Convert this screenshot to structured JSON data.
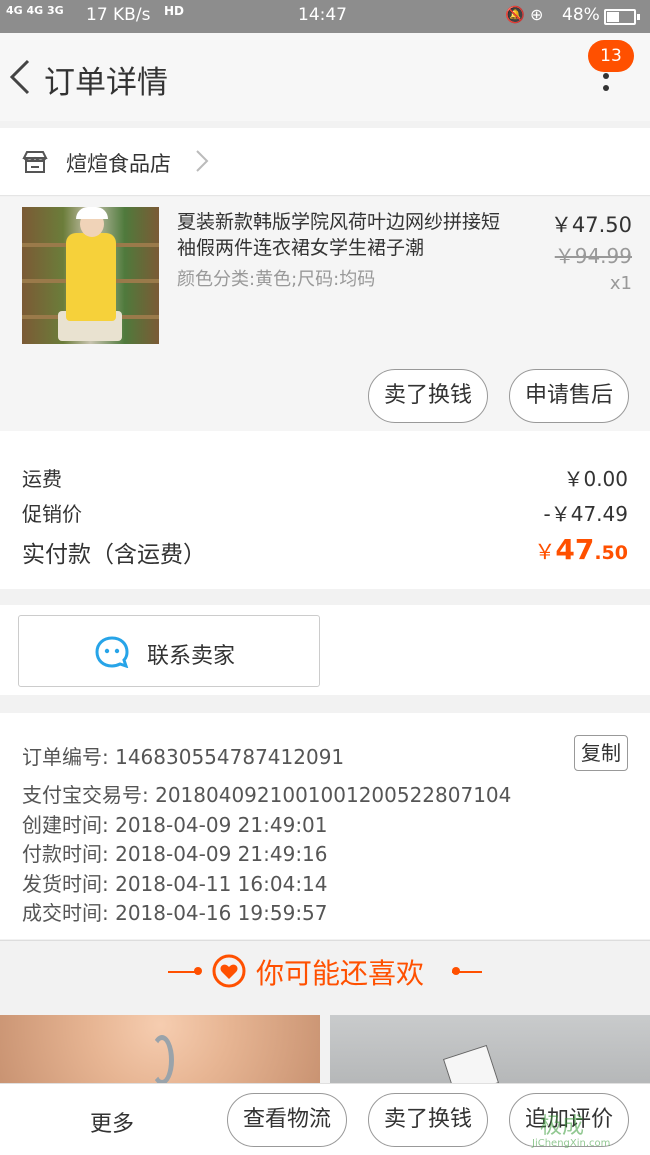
{
  "status_bar": {
    "signal": "4G 4G 3G",
    "net_speed": "17 KB/s",
    "hd": "HD",
    "time": "14:47",
    "icons": "🔕 ⊕",
    "battery_pct": "48%",
    "battery_level": 0.48
  },
  "header": {
    "title": "订单详情",
    "badge": "13"
  },
  "shop": {
    "name": "煊煊食品店"
  },
  "product": {
    "name": "夏装新款韩版学院风荷叶边网纱拼接短袖假两件连衣裙女学生裙子潮",
    "sku": "颜色分类:黄色;尺码:均码",
    "price": "￥47.50",
    "original_price": "￥94.99",
    "quantity": "x1",
    "actions": {
      "resell": "卖了换钱",
      "after_sale": "申请售后"
    }
  },
  "fees": {
    "shipping_label": "运费",
    "shipping_value": "￥0.00",
    "promo_label": "促销价",
    "promo_value": "-￥47.49",
    "paid_label": "实付款（含运费）",
    "paid_symbol": "￥",
    "paid_int": "47",
    "paid_dec": ".50"
  },
  "contact": {
    "label": "联系卖家"
  },
  "order_info": {
    "copy_label": "复制",
    "rows": [
      "订单编号: 146830554787412091",
      "支付宝交易号: 2018040921001001200522807104",
      "创建时间: 2018-04-09 21:49:01",
      "付款时间: 2018-04-09 21:49:16",
      "发货时间: 2018-04-11 16:04:14",
      "成交时间: 2018-04-16 19:59:57"
    ]
  },
  "recommend": {
    "title": "你可能还喜欢"
  },
  "bottom_bar": {
    "more": "更多",
    "logistics": "查看物流",
    "resell": "卖了换钱",
    "review": "追加评价"
  },
  "watermark": {
    "text": "极成",
    "url": "JiChengXin.com"
  },
  "colors": {
    "accent": "#ff5000",
    "status_bar": "#8d8d8d",
    "contact_icon": "#27a4e8"
  }
}
